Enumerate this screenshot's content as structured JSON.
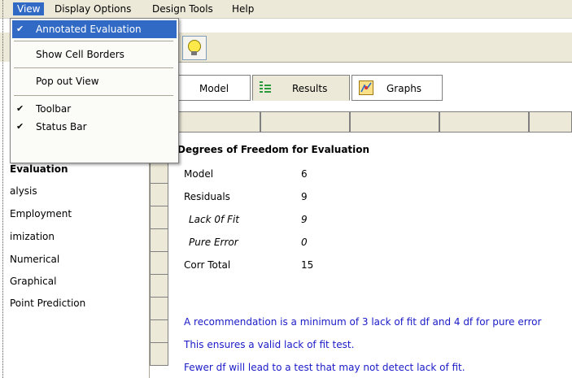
{
  "menubar": {
    "view": "View",
    "display_options": "Display Options",
    "design_tools": "Design Tools",
    "help": "Help"
  },
  "view_menu": {
    "items": [
      {
        "label": "Annotated Evaluation",
        "checked": true
      },
      {
        "label": "Show Cell Borders",
        "checked": false
      },
      {
        "label": "Pop out View",
        "checked": false
      },
      {
        "label": "Toolbar",
        "checked": true
      },
      {
        "label": "Status Bar",
        "checked": true
      }
    ],
    "check_glyph": "✔"
  },
  "left_panel": {
    "items": [
      "Evaluation",
      "alysis",
      "Employment",
      "imization",
      "Numerical",
      "Graphical",
      "Point Prediction"
    ]
  },
  "tabs": [
    {
      "label": "Model",
      "icon": "model-icon"
    },
    {
      "label": "Results",
      "icon": "results-icon"
    },
    {
      "label": "Graphs",
      "icon": "graphs-icon"
    }
  ],
  "evaluation": {
    "title": "Degrees of Freedom for Evaluation",
    "rows": [
      {
        "label": "Model",
        "value": "6"
      },
      {
        "label": "Residuals",
        "value": "9"
      },
      {
        "label": "Lack 0f Fit",
        "value": "9"
      },
      {
        "label": "Pure Error",
        "value": "0"
      },
      {
        "label": "Corr Total",
        "value": "15"
      }
    ],
    "notes": [
      "A recommendation is a minimum of 3 lack of fit df and 4 df for pure error",
      "This ensures a valid lack of fit test.",
      "Fewer df will lead to a test that may not detect lack of fit."
    ]
  },
  "colors": {
    "menu_highlight": "#316ac5",
    "note_text": "#1a1ac8",
    "chrome": "#ece9d8"
  }
}
